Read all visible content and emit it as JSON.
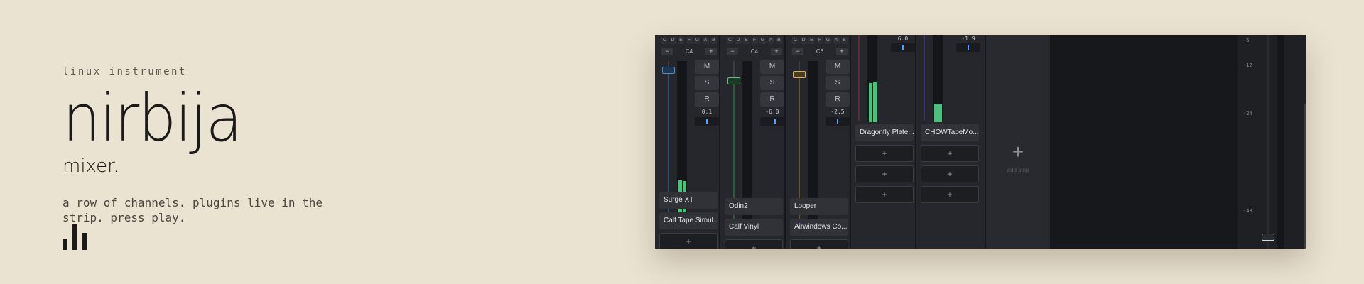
{
  "hero": {
    "kicker": "linux instrument",
    "title": "nirbija",
    "subtitle": "mixer.",
    "description": "a row of channels. plugins live in the strip. press play."
  },
  "mixer": {
    "keys": [
      "C",
      "D",
      "E",
      "F",
      "G",
      "A",
      "B"
    ],
    "octave_minus": "−",
    "octave_plus": "+",
    "button_m": "M",
    "button_s": "S",
    "button_r": "R",
    "slot_plus": "+",
    "strips": [
      {
        "octave": "C4",
        "pan_value": "0.1",
        "plugins": [
          "Surge XT",
          "Calf Tape Simul..."
        ]
      },
      {
        "octave": "C4",
        "pan_value": "-6.0",
        "plugins": [
          "Odin2",
          "Calf Vinyl"
        ]
      },
      {
        "octave": "C6",
        "pan_value": "-2.5",
        "plugins": [
          "Looper",
          "Airwindows Co..."
        ]
      },
      {
        "pan_value": "6.0",
        "plugins": [
          "Dragonfly Plate..."
        ]
      },
      {
        "pan_value": "-1.9",
        "plugins": [
          "CHOWTapeMo..."
        ]
      }
    ],
    "add_strip_icon": "+",
    "add_strip_label": "add strip",
    "master_db_labels": [
      "-6",
      "-12",
      "-24",
      "-48"
    ]
  },
  "colors": {
    "background": "#ebe3d2",
    "meter": "#3ec97a",
    "pan_indicator": "#4da3ff"
  }
}
